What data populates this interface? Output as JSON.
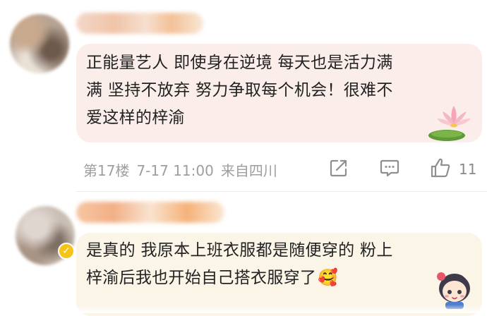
{
  "comments": [
    {
      "text_lines": [
        "正能量艺人 即使身在逆境 每天也是活力满",
        "满 坚持不放弃 努力争取每个机会！很难不",
        "爱这样的梓渝"
      ],
      "floor": "第17楼",
      "date": "7-17 11:00",
      "location": "来自四川",
      "like_count": "11",
      "bubble_color": "#fbeeea",
      "sticker": "lotus-sticker"
    },
    {
      "text_lines": [
        "是真的 我原本上班衣服都是随便穿的 粉上",
        "梓渝后我也开始自己搭衣服穿了"
      ],
      "emoji": "🥰",
      "bubble_color": "#fbf5e8",
      "sticker": "chibi-character-sticker",
      "badge": "verified-badge"
    }
  ],
  "icons": {
    "share": "share-icon",
    "comment": "comment-icon",
    "like": "thumbs-up-icon"
  }
}
